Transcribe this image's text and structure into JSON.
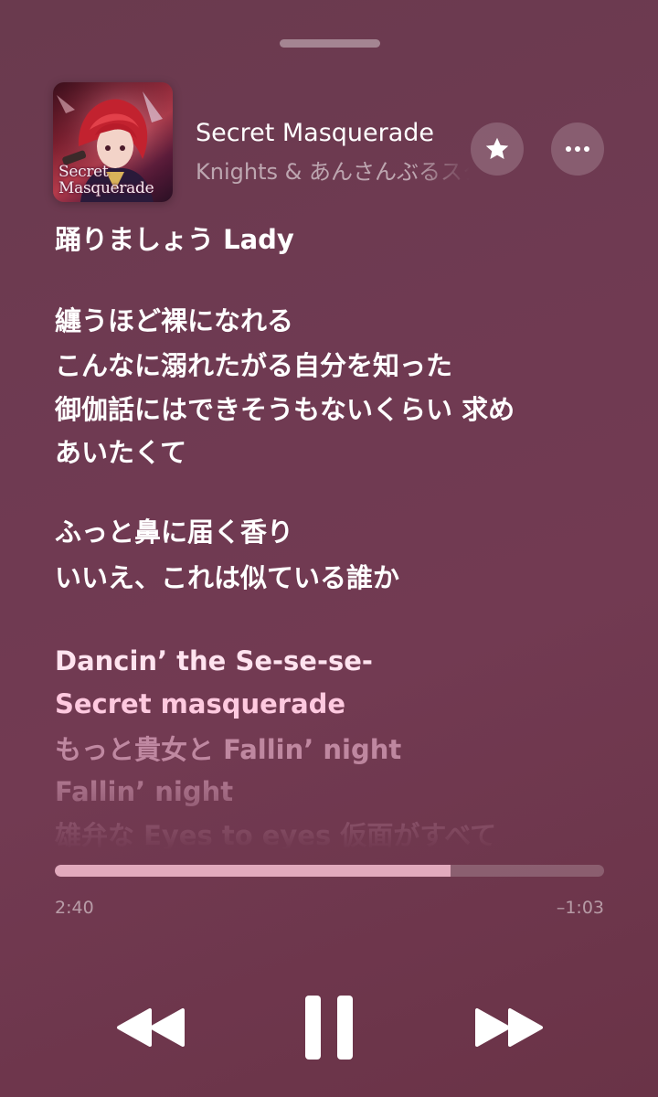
{
  "player": {
    "song_title": "Secret Masquerade",
    "artist": "Knights & あんさんぶるスターズ！！",
    "album_art_text": [
      "Secret",
      "Masquerade"
    ],
    "progress_fraction": 0.72,
    "elapsed": "2:40",
    "remaining": "–1:03"
  },
  "lyrics": [
    "踊りましょう Lady",
    "纏うほど裸になれる",
    "こんなに溺れたがる自分を知った",
    "御伽話にはできそうもないくらい 求め",
    "あいたくて",
    "ふっと鼻に届く香り",
    "いいえ、これは似ている誰か",
    "Dancin’ the Se-se-se-",
    "Secret masquerade",
    "もっと貴女と Fallin’ night",
    "Fallin’ night",
    "雄弁な Eyes to eyes 仮面がすべて"
  ],
  "icons": {
    "favorite": "star-icon",
    "more": "ellipsis-icon",
    "rewind": "rewind-icon",
    "pause": "pause-icon",
    "forward": "fast-forward-icon"
  },
  "colors": {
    "background": "#6f3a52",
    "progress_fill": "#e2aabd",
    "active_lyric": "#ffe3ef"
  }
}
